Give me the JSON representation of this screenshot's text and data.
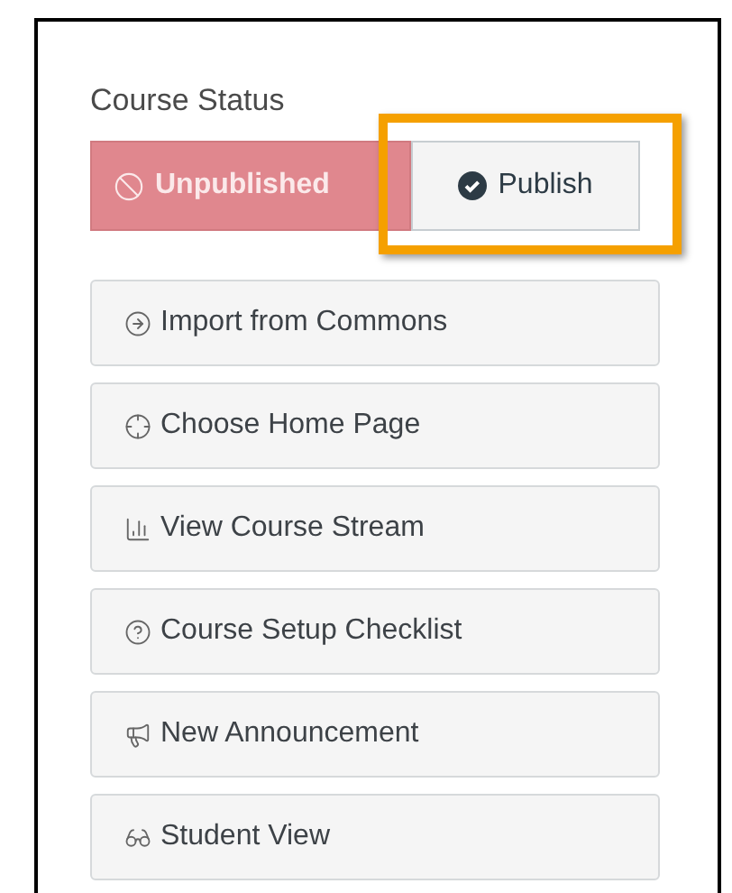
{
  "course_status": {
    "title": "Course Status",
    "options": [
      {
        "label": "Unpublished",
        "selected": true,
        "kind": "unpublish"
      },
      {
        "label": "Publish",
        "selected": false,
        "kind": "publish",
        "highlighted": true
      }
    ]
  },
  "actions": [
    {
      "label": "Import from Commons",
      "kind": "import"
    },
    {
      "label": "Choose Home Page",
      "kind": "home"
    },
    {
      "label": "View Course Stream",
      "kind": "stream"
    },
    {
      "label": "Course Setup Checklist",
      "kind": "checklist"
    },
    {
      "label": "New Announcement",
      "kind": "announcement"
    },
    {
      "label": "Student View",
      "kind": "student"
    }
  ]
}
